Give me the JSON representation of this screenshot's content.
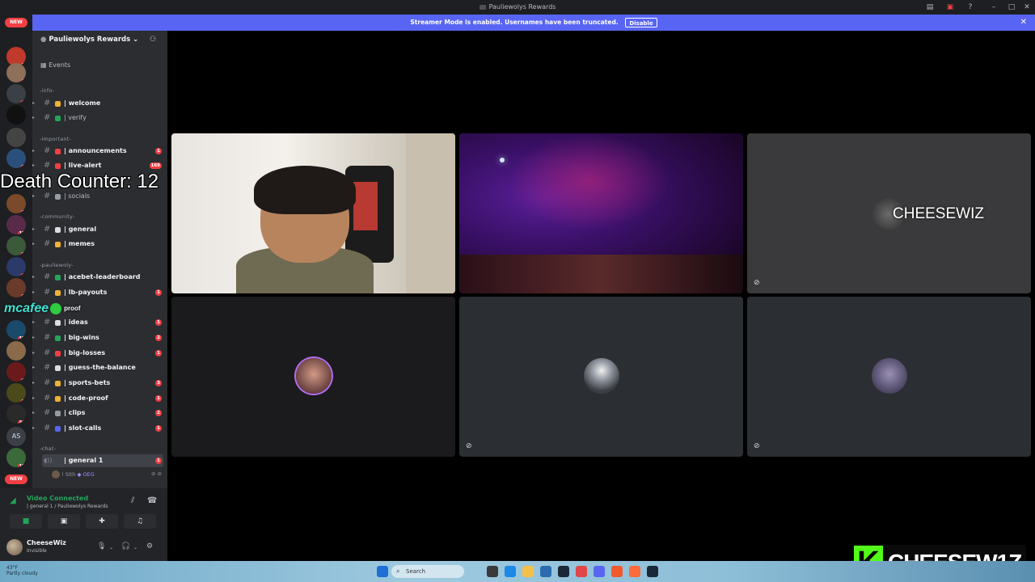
{
  "window": {
    "title": "Pauliewolys Rewards"
  },
  "banner": {
    "text": "Streamer Mode is enabled. Usernames have been truncated.",
    "disable_label": "Disable"
  },
  "servers": {
    "new_top": "NEW",
    "new_bottom": "NEW",
    "initials": "AS",
    "badges": [
      "1",
      "17",
      "62",
      "47",
      "30",
      "30",
      "37",
      "131",
      "26",
      "43",
      "24",
      "182",
      "6",
      "10",
      "14",
      "243",
      "187"
    ]
  },
  "guild": {
    "name": "Pauliewolys Rewards",
    "events_label": "Events"
  },
  "categories": {
    "info": "-info-",
    "important": "-important-",
    "community": "-community-",
    "pauliewoly": "-pauliewoly-",
    "chat": "-chat-"
  },
  "channels": [
    {
      "name": "| welcome",
      "badge": "",
      "color": "#f0b232"
    },
    {
      "name": "| verify",
      "badge": "",
      "color": "#23a55a"
    },
    {
      "name": "| announcements",
      "badge": "1",
      "color": "#f23f43"
    },
    {
      "name": "| live-alert",
      "badge": "169",
      "color": "#f23f43"
    },
    {
      "name": "| socials",
      "badge": "",
      "color": "#949ba4"
    },
    {
      "name": "| general",
      "badge": "",
      "color": "#dbdee1"
    },
    {
      "name": "| memes",
      "badge": "",
      "color": "#f0b232"
    },
    {
      "name": "| acebet-leaderboard",
      "badge": "",
      "color": "#23a55a"
    },
    {
      "name": "| lb-payouts",
      "badge": "1",
      "color": "#f0b232"
    },
    {
      "name": "| ideas",
      "badge": "1",
      "color": "#dbdee1"
    },
    {
      "name": "| big-wins",
      "badge": "2",
      "color": "#23a55a"
    },
    {
      "name": "| big-losses",
      "badge": "1",
      "color": "#f23f43"
    },
    {
      "name": "| guess-the-balance",
      "badge": "",
      "color": "#dbdee1"
    },
    {
      "name": "| sports-bets",
      "badge": "3",
      "color": "#f0b232"
    },
    {
      "name": "| code-proof",
      "badge": "1",
      "color": "#f0b232"
    },
    {
      "name": "| clips",
      "badge": "2",
      "color": "#949ba4"
    },
    {
      "name": "| slot-calls",
      "badge": "1",
      "color": "#5865f2"
    }
  ],
  "voice_channel": {
    "name": "| general 1",
    "badge": "1",
    "member": "! Sith",
    "member_tag": "OEG"
  },
  "voice_panel": {
    "status": "Video Connected",
    "location": "| general 1 / Pauliewolys Rewards"
  },
  "user": {
    "name": "CheeseWiz",
    "status": "Invisible"
  },
  "overlay": {
    "death_counter": "Death Counter: 12",
    "mcafee": "mcafee",
    "proof_fragment": "proof"
  },
  "tiles": {
    "t3_name": "CHEESEWIZ"
  },
  "kick": {
    "logo": "K",
    "name": "CHEESEW1Z"
  },
  "taskbar": {
    "weather_temp": "43°F",
    "weather_desc": "Partly cloudy",
    "search": "Search"
  }
}
